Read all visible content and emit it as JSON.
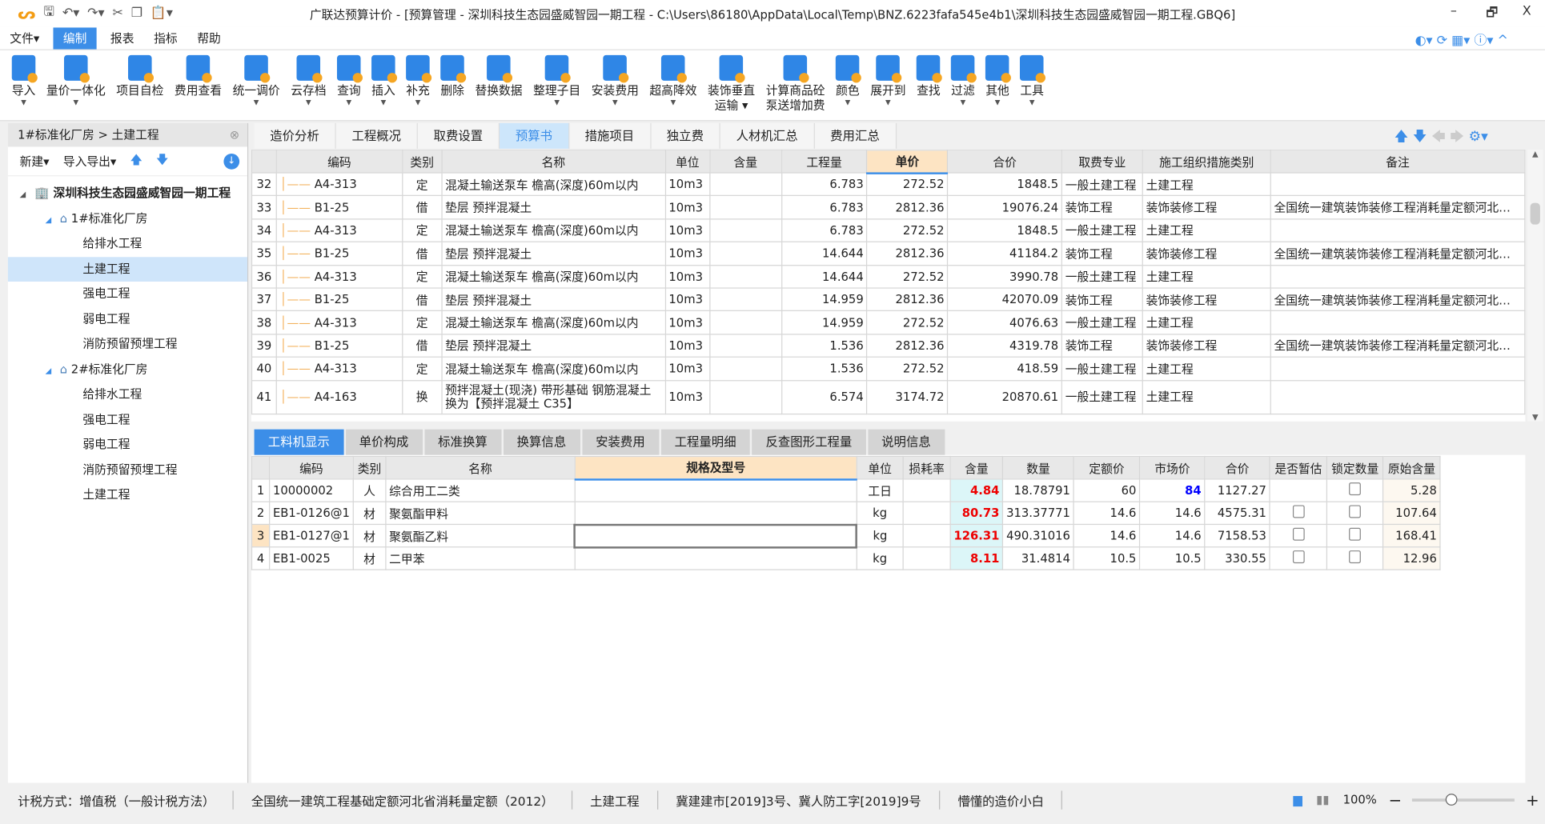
{
  "title": "广联达预算计价 - [预算管理 - 深圳科技生态园盛威智园一期工程 - C:\\Users\\86180\\AppData\\Local\\Temp\\BNZ.6223fafa545e4b1\\深圳科技生态园盛威智园一期工程.GBQ6]",
  "window_controls": [
    "–",
    "🗗",
    "X"
  ],
  "menu": [
    "文件▾",
    "编制",
    "报表",
    "指标",
    "帮助"
  ],
  "menu_active": 1,
  "ribbon": [
    {
      "label": "导入",
      "dd": true
    },
    {
      "label": "量价一体化",
      "dd": true
    },
    {
      "label": "项目自检",
      "dd": false
    },
    {
      "label": "费用查看",
      "dd": false
    },
    {
      "label": "统一调价",
      "dd": true
    },
    {
      "label": "云存档",
      "dd": true
    },
    {
      "label": "查询",
      "dd": true
    },
    {
      "label": "插入",
      "dd": true
    },
    {
      "label": "补充",
      "dd": true
    },
    {
      "label": "删除",
      "dd": false
    },
    {
      "label": "替换数据",
      "dd": false
    },
    {
      "label": "整理子目",
      "dd": true
    },
    {
      "label": "安装费用",
      "dd": true
    },
    {
      "label": "超高降效",
      "dd": true
    },
    {
      "label": "装饰垂直\n运输 ▾",
      "dd": false
    },
    {
      "label": "计算商品砼\n泵送增加费",
      "dd": false
    },
    {
      "label": "颜色",
      "dd": true
    },
    {
      "label": "展开到",
      "dd": true
    },
    {
      "label": "查找",
      "dd": false
    },
    {
      "label": "过滤",
      "dd": true
    },
    {
      "label": "其他",
      "dd": true
    },
    {
      "label": "工具",
      "dd": true
    }
  ],
  "left": {
    "breadcrumb": "1#标准化厂房 > 土建工程",
    "toolbar": [
      "新建▾",
      "导入导出▾"
    ],
    "tree": [
      {
        "label": "深圳科技生态园盛威智园一期工程",
        "level": 0,
        "bold": true
      },
      {
        "label": "1#标准化厂房",
        "level": 1
      },
      {
        "label": "给排水工程",
        "level": 2
      },
      {
        "label": "土建工程",
        "level": 2,
        "selected": true
      },
      {
        "label": "强电工程",
        "level": 2
      },
      {
        "label": "弱电工程",
        "level": 2
      },
      {
        "label": "消防预留预埋工程",
        "level": 2
      },
      {
        "label": "2#标准化厂房",
        "level": 1
      },
      {
        "label": "给排水工程",
        "level": 2
      },
      {
        "label": "强电工程",
        "level": 2
      },
      {
        "label": "弱电工程",
        "level": 2
      },
      {
        "label": "消防预留预埋工程",
        "level": 2
      },
      {
        "label": "土建工程",
        "level": 2
      }
    ]
  },
  "tabs": [
    "造价分析",
    "工程概况",
    "取费设置",
    "预算书",
    "措施项目",
    "独立费",
    "人材机汇总",
    "费用汇总"
  ],
  "tab_active": 3,
  "upper": {
    "columns": [
      "",
      "编码",
      "类别",
      "名称",
      "单位",
      "含量",
      "工程量",
      "单价",
      "合价",
      "取费专业",
      "施工组织措施类别",
      "备注"
    ],
    "rows": [
      [
        "32",
        "A4-313",
        "定",
        "混凝土输送泵车 檐高(深度)60m以内",
        "10m3",
        "",
        "6.783",
        "272.52",
        "1848.5",
        "一般土建工程",
        "土建工程",
        ""
      ],
      [
        "33",
        "B1-25",
        "借",
        "垫层 预拌混凝土",
        "10m3",
        "",
        "6.783",
        "2812.36",
        "19076.24",
        "装饰工程",
        "装饰装修工程",
        "全国统一建筑装饰装修工程消耗量定额河北…"
      ],
      [
        "34",
        "A4-313",
        "定",
        "混凝土输送泵车 檐高(深度)60m以内",
        "10m3",
        "",
        "6.783",
        "272.52",
        "1848.5",
        "一般土建工程",
        "土建工程",
        ""
      ],
      [
        "35",
        "B1-25",
        "借",
        "垫层 预拌混凝土",
        "10m3",
        "",
        "14.644",
        "2812.36",
        "41184.2",
        "装饰工程",
        "装饰装修工程",
        "全国统一建筑装饰装修工程消耗量定额河北…"
      ],
      [
        "36",
        "A4-313",
        "定",
        "混凝土输送泵车 檐高(深度)60m以内",
        "10m3",
        "",
        "14.644",
        "272.52",
        "3990.78",
        "一般土建工程",
        "土建工程",
        ""
      ],
      [
        "37",
        "B1-25",
        "借",
        "垫层 预拌混凝土",
        "10m3",
        "",
        "14.959",
        "2812.36",
        "42070.09",
        "装饰工程",
        "装饰装修工程",
        "全国统一建筑装饰装修工程消耗量定额河北…"
      ],
      [
        "38",
        "A4-313",
        "定",
        "混凝土输送泵车 檐高(深度)60m以内",
        "10m3",
        "",
        "14.959",
        "272.52",
        "4076.63",
        "一般土建工程",
        "土建工程",
        ""
      ],
      [
        "39",
        "B1-25",
        "借",
        "垫层 预拌混凝土",
        "10m3",
        "",
        "1.536",
        "2812.36",
        "4319.78",
        "装饰工程",
        "装饰装修工程",
        "全国统一建筑装饰装修工程消耗量定额河北…"
      ],
      [
        "40",
        "A4-313",
        "定",
        "混凝土输送泵车 檐高(深度)60m以内",
        "10m3",
        "",
        "1.536",
        "272.52",
        "418.59",
        "一般土建工程",
        "土建工程",
        ""
      ],
      [
        "41",
        "A4-163",
        "换",
        "预拌混凝土(现浇) 带形基础 钢筋混凝土 换为【预拌混凝土 C35】",
        "10m3",
        "",
        "6.574",
        "3174.72",
        "20870.61",
        "一般土建工程",
        "土建工程",
        ""
      ]
    ]
  },
  "lower_tabs": [
    "工料机显示",
    "单价构成",
    "标准换算",
    "换算信息",
    "安装费用",
    "工程量明细",
    "反查图形工程量",
    "说明信息"
  ],
  "lower_tab_active": 0,
  "lower": {
    "columns": [
      "",
      "编码",
      "类别",
      "名称",
      "规格及型号",
      "单位",
      "损耗率",
      "含量",
      "数量",
      "定额价",
      "市场价",
      "合价",
      "是否暂估",
      "锁定数量",
      "原始含量"
    ],
    "rows": [
      {
        "no": "1",
        "code": "10000002",
        "type": "人",
        "name": "综合用工二类",
        "spec": "",
        "unit": "工日",
        "loss": "",
        "qty_per": "4.84",
        "qty": "18.78791",
        "quota_price": "60",
        "market_price": "84",
        "total": "1127.27",
        "provisional": null,
        "locked": false,
        "orig": "5.28"
      },
      {
        "no": "2",
        "code": "EB1-0126@1",
        "type": "材",
        "name": "聚氨酯甲料",
        "spec": "",
        "unit": "kg",
        "loss": "",
        "qty_per": "80.73",
        "qty": "313.37771",
        "quota_price": "14.6",
        "market_price": "14.6",
        "total": "4575.31",
        "provisional": false,
        "locked": false,
        "orig": "107.64"
      },
      {
        "no": "3",
        "code": "EB1-0127@1",
        "type": "材",
        "name": "聚氨酯乙料",
        "spec": "",
        "unit": "kg",
        "loss": "",
        "qty_per": "126.31",
        "qty": "490.31016",
        "quota_price": "14.6",
        "market_price": "14.6",
        "total": "7158.53",
        "provisional": false,
        "locked": false,
        "orig": "168.41"
      },
      {
        "no": "4",
        "code": "EB1-0025",
        "type": "材",
        "name": "二甲苯",
        "spec": "",
        "unit": "kg",
        "loss": "",
        "qty_per": "8.11",
        "qty": "31.4814",
        "quota_price": "10.5",
        "market_price": "10.5",
        "total": "330.55",
        "provisional": false,
        "locked": false,
        "orig": "12.96"
      }
    ]
  },
  "status": [
    "计税方式：增值税（一般计税方法）",
    "全国统一建筑工程基础定额河北省消耗量定额（2012）",
    "土建工程",
    "冀建建市[2019]3号、冀人防工字[2019]9号",
    "懵懂的造价小白"
  ],
  "zoom": "100%",
  "colors": {
    "accent": "#3c8ee8",
    "highlight_header": "#fde4c3",
    "red_value": "#e00000",
    "blue_value": "#0000ff"
  }
}
